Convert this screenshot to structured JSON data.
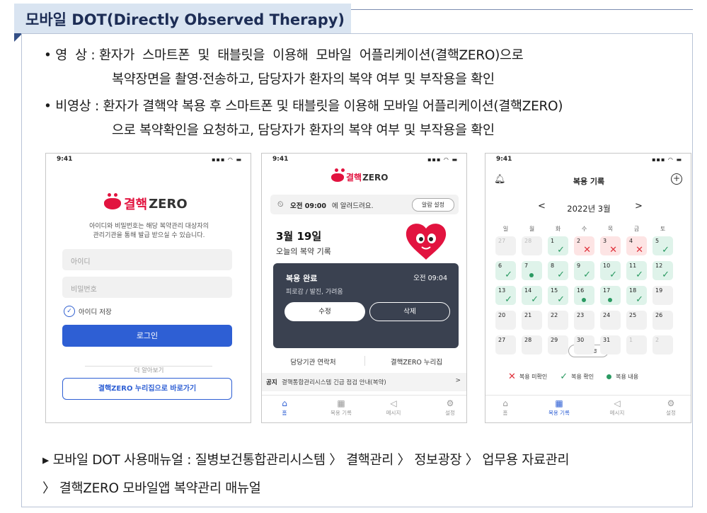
{
  "header": {
    "title": "모바일 DOT(Directly Observed Therapy)"
  },
  "bullets": [
    {
      "marker": "•",
      "label": "영  상",
      "colon": ":",
      "text1": "환자가  스마트폰  및  태블릿을  이용해  모바일  어플리케이션(결핵ZERO)으로",
      "text2": "복약장면을 촬영·전송하고, 담당자가 환자의 복약 여부 및 부작용을 확인"
    },
    {
      "marker": "•",
      "label": "비영상",
      "colon": ":",
      "text1": "환자가 결핵약 복용 후 스마트폰 및 태블릿을 이용해 모바일 어플리케이션(결핵ZERO)",
      "text2": "으로 복약확인을 요청하고, 담당자가 환자의 복약 여부 및 부작용을 확인"
    }
  ],
  "phone1": {
    "time": "9:41",
    "signal": "▪▪▪ ◠ ▬",
    "logo_k": "결핵",
    "logo_z": "ZERO",
    "desc1": "아이디와 비밀번호는 해당 복약관리 대상자의",
    "desc2": "관리기관을 통해 발급 받으실 수 있습니다.",
    "id_placeholder": "아이디",
    "pw_placeholder": "비밀번호",
    "save_id": "아이디 저장",
    "login": "로그인",
    "more": "더 알아보기",
    "link": "결핵ZERO 누리집으로 바로가기"
  },
  "phone2": {
    "time": "9:41",
    "signal": "▪▪▪ ◠ ▬",
    "logo_k": "결핵",
    "logo_z": "ZERO",
    "alarm_time": "오전 09:00",
    "alarm_text": "에 알려드려요.",
    "alarm_btn": "알람 설정",
    "date": "3월 19일",
    "record_label": "오늘의 복약 기록",
    "done": "복용 완료",
    "done_time": "오전 09:04",
    "symptoms": "피로감 / 발진, 가려움",
    "edit": "수정",
    "delete": "삭제",
    "contact": "담당기관 연락처",
    "site": "결핵ZERO 누리집",
    "notice_label": "공지",
    "notice": "결핵통합관리시스템 긴급 점검 안내(복약)",
    "notice_arrow": ">",
    "nav": [
      "홈",
      "복용 기록",
      "메시지",
      "설정"
    ]
  },
  "phone3": {
    "time": "9:41",
    "signal": "▪▪▪ ◠ ▬",
    "title": "복용 기록",
    "prev": "<",
    "month": "2022년 3월",
    "next": ">",
    "weekdays": [
      "일",
      "월",
      "화",
      "수",
      "목",
      "금",
      "토"
    ],
    "today_btn": "오늘",
    "legend": [
      "복용 미확인",
      "복용 확인",
      "복용 내용"
    ],
    "nav": [
      "홈",
      "복용 기록",
      "메시지",
      "설정"
    ]
  },
  "footer": {
    "line1": "▸ 모바일 DOT 사용매뉴얼 : 질병보건통합관리시스템 〉 결핵관리 〉 정보광장 〉 업무용 자료관리",
    "line2": "〉 결핵ZERO 모바일앱 복약관리 매뉴얼"
  },
  "calendar": [
    {
      "d": "27",
      "s": "n"
    },
    {
      "d": "28",
      "s": "n"
    },
    {
      "d": "1",
      "s": "c"
    },
    {
      "d": "2",
      "s": "x"
    },
    {
      "d": "3",
      "s": "x"
    },
    {
      "d": "4",
      "s": "x"
    },
    {
      "d": "5",
      "s": "c"
    },
    {
      "d": "6",
      "s": "c"
    },
    {
      "d": "7",
      "s": "o"
    },
    {
      "d": "8",
      "s": "c"
    },
    {
      "d": "9",
      "s": "c"
    },
    {
      "d": "10",
      "s": "c"
    },
    {
      "d": "11",
      "s": "c"
    },
    {
      "d": "12",
      "s": "c"
    },
    {
      "d": "13",
      "s": "c"
    },
    {
      "d": "14",
      "s": "c"
    },
    {
      "d": "15",
      "s": "c"
    },
    {
      "d": "16",
      "s": "o"
    },
    {
      "d": "17",
      "s": "o"
    },
    {
      "d": "18",
      "s": "c"
    },
    {
      "d": "19",
      "s": "e"
    },
    {
      "d": "20",
      "s": "e"
    },
    {
      "d": "21",
      "s": "e"
    },
    {
      "d": "22",
      "s": "e"
    },
    {
      "d": "23",
      "s": "e"
    },
    {
      "d": "24",
      "s": "e"
    },
    {
      "d": "25",
      "s": "e"
    },
    {
      "d": "26",
      "s": "e"
    },
    {
      "d": "27",
      "s": "e"
    },
    {
      "d": "28",
      "s": "e"
    },
    {
      "d": "29",
      "s": "e"
    },
    {
      "d": "30",
      "s": "e"
    },
    {
      "d": "31",
      "s": "e"
    },
    {
      "d": "1",
      "s": "n"
    },
    {
      "d": "2",
      "s": "n"
    }
  ]
}
